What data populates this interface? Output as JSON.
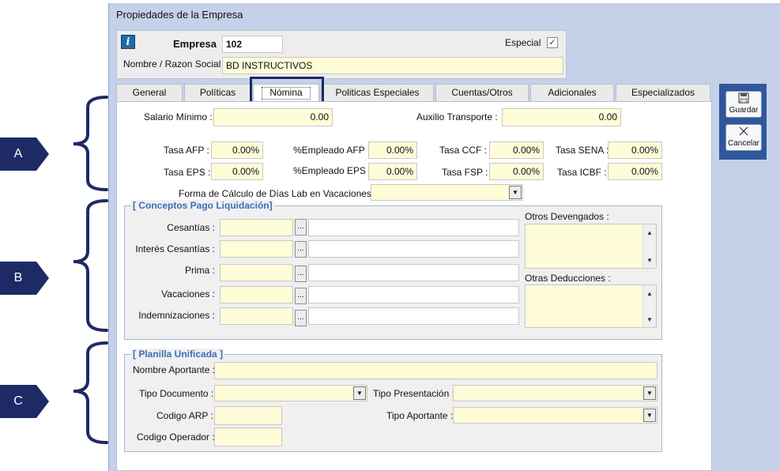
{
  "window": {
    "title": "Propiedades de la Empresa"
  },
  "header": {
    "empresa_label": "Empresa",
    "empresa_value": "102",
    "especial_label": "Especial",
    "especial_checked": "✓",
    "nombre_label": "Nombre / Razon Social",
    "nombre_value": "BD INSTRUCTIVOS"
  },
  "tabs": [
    "General",
    "Políticas",
    "Nómina",
    "Politicas Especiales",
    "Cuentas/Otros",
    "Adicionales",
    "Especializados"
  ],
  "active_tab": "Nómina",
  "nomina": {
    "salario_minimo_label": "Salario Mínimo :",
    "salario_minimo_value": "0.00",
    "auxilio_transporte_label": "Auxilio Transporte :",
    "auxilio_transporte_value": "0.00",
    "tasa_afp_label": "Tasa AFP :",
    "tasa_afp_value": "0.00%",
    "empleado_afp_label": "%Empleado AFP :",
    "empleado_afp_value": "0.00%",
    "tasa_ccf_label": "Tasa CCF :",
    "tasa_ccf_value": "0.00%",
    "tasa_sena_label": "Tasa SENA :",
    "tasa_sena_value": "0.00%",
    "tasa_eps_label": "Tasa EPS :",
    "tasa_eps_value": "0.00%",
    "empleado_eps_label": "%Empleado EPS :",
    "empleado_eps_value": "0.00%",
    "tasa_fsp_label": "Tasa FSP :",
    "tasa_fsp_value": "0.00%",
    "tasa_icbf_label": "Tasa ICBF :",
    "tasa_icbf_value": "0.00%",
    "forma_calculo_label": "Forma de Cálculo de Días Lab en Vacaciones :"
  },
  "conceptos": {
    "title": "[ Conceptos Pago Liquidación]",
    "rows": [
      {
        "label": "Cesantías :"
      },
      {
        "label": "Interés Cesantías :"
      },
      {
        "label": "Prima :"
      },
      {
        "label": "Vacaciones :"
      },
      {
        "label": "Indemnizaciones :"
      }
    ],
    "dots": "...",
    "otros_devengados_label": "Otros Devengados :",
    "otras_deducciones_label": "Otras Deducciones :"
  },
  "planilla": {
    "title": "[ Planilla Unificada ]",
    "nombre_aportante_label": "Nombre Aportante :",
    "tipo_documento_label": "Tipo Documento :",
    "tipo_presentacion_label": "Tipo Presentación :",
    "codigo_arp_label": "Codigo ARP :",
    "tipo_aportante_label": "Tipo Aportante :",
    "codigo_operador_label": "Codigo Operador :"
  },
  "side_buttons": {
    "guardar": "Guardar",
    "cancelar": "Cancelar"
  },
  "markers": [
    "A",
    "B",
    "C"
  ],
  "icons": {
    "info": "info-icon",
    "save": "floppy-disk-icon",
    "cancel": "x-cross-icon",
    "dropdown": "chevron-down-icon"
  },
  "colors": {
    "marker": "#1e2a66",
    "field": "#fffcd8",
    "window": "#c4d1e8",
    "side_panel": "#2f579b",
    "group_title": "#3d6fb6"
  }
}
